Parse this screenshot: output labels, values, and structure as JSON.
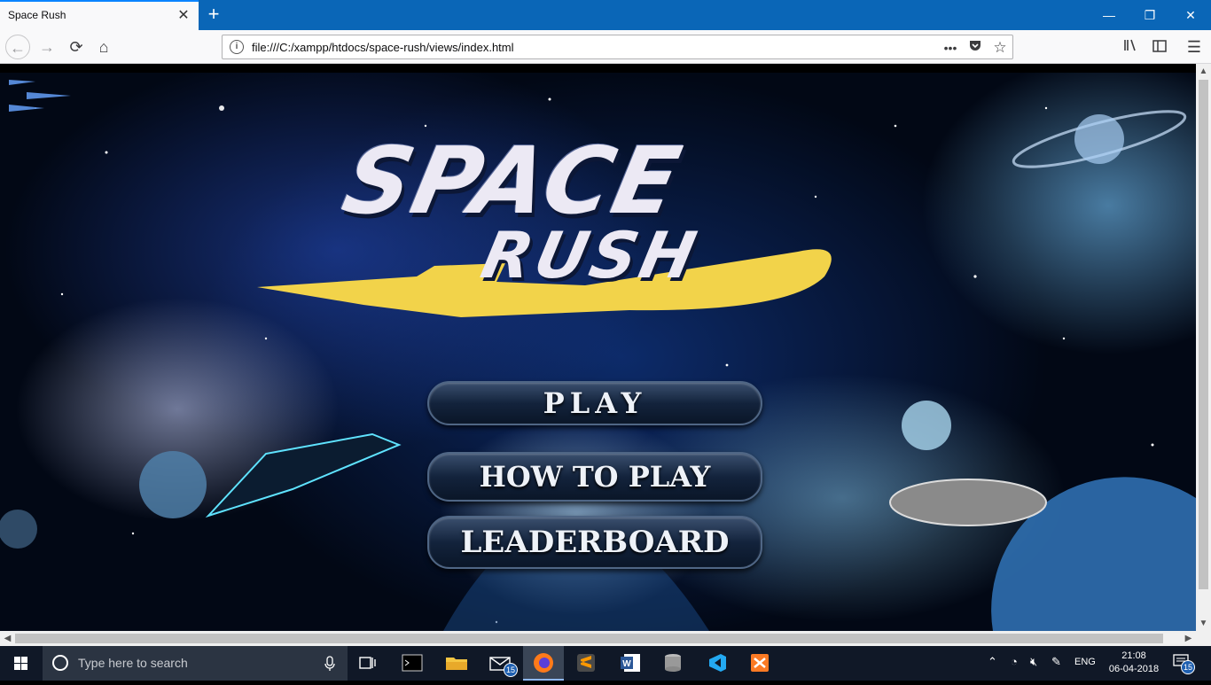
{
  "browser": {
    "tab_title": "Space Rush",
    "tab_close": "✕",
    "new_tab": "+",
    "window_controls": {
      "minimize": "—",
      "restore": "❐",
      "close": "✕"
    },
    "url": "file:///C:/xampp/htdocs/space-rush/views/index.html",
    "url_info": "i",
    "page_actions": "•••",
    "icons": [
      "back-icon",
      "forward-icon",
      "reload-icon",
      "home-icon",
      "pocket-icon",
      "bookmark-star-icon",
      "library-icon",
      "sidebar-icon",
      "menu-icon"
    ]
  },
  "page": {
    "logo_line1": "SPACE",
    "logo_line2": "RUSH",
    "menu": {
      "play": "PLAY",
      "how_to_play": "HOW TO PLAY",
      "leaderboard": "LEADERBOARD"
    },
    "colors": {
      "logo_text": "#ece9f4",
      "logo_streak": "#f2d34a",
      "button_bg": "#13233c"
    }
  },
  "taskbar": {
    "search_placeholder": "Type here to search",
    "mail_badge": "15",
    "notification_badge": "15",
    "language": "ENG",
    "time": "21:08",
    "date": "06-04-2018",
    "pinned": [
      "task-view-icon",
      "terminal-icon",
      "file-explorer-icon",
      "mail-icon",
      "firefox-icon",
      "sublime-text-icon",
      "word-icon",
      "database-icon",
      "vscode-icon",
      "xampp-icon"
    ]
  }
}
